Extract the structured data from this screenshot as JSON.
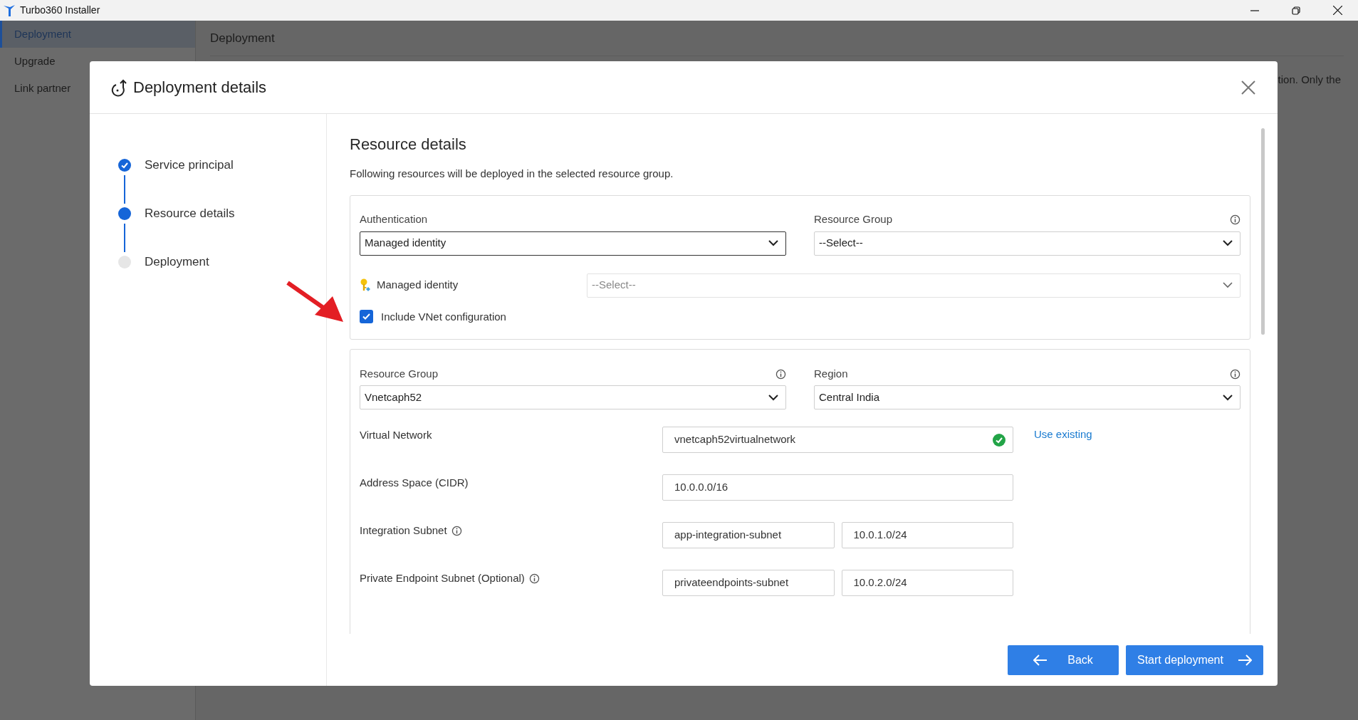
{
  "window": {
    "title": "Turbo360 Installer"
  },
  "sidebar": {
    "items": [
      {
        "label": "Deployment",
        "selected": true
      },
      {
        "label": "Upgrade",
        "selected": false
      },
      {
        "label": "Link partner",
        "selected": false
      }
    ]
  },
  "page": {
    "title": "Deployment",
    "text": "tion. Only the"
  },
  "dialog": {
    "title": "Deployment details",
    "steps": [
      {
        "label": "Service principal",
        "done": true,
        "selected": false
      },
      {
        "label": "Resource details",
        "done": false,
        "selected": true
      },
      {
        "label": "Deployment",
        "done": false,
        "selected": false
      }
    ],
    "section": {
      "title": "Resource details",
      "description": "Following resources will be deployed in the selected resource group."
    },
    "auth_card": {
      "authentication": {
        "label": "Authentication",
        "value": "Managed identity",
        "info": false,
        "focused": true
      },
      "resource_group": {
        "label": "Resource Group",
        "value": "--Select--",
        "info": true,
        "focused": false
      },
      "managed_identity": {
        "label": "Managed identity",
        "placeholder": "--Select--",
        "disabled": true
      },
      "vnet_checkbox": {
        "label": "Include VNet configuration",
        "checked": true
      }
    },
    "vnet_card": {
      "resource_group": {
        "label": "Resource Group",
        "value": "Vnetcaph52",
        "info": true,
        "focused": false
      },
      "region": {
        "label": "Region",
        "value": "Central India",
        "info": true,
        "focused": false
      },
      "rows": [
        {
          "label": "Virtual Network",
          "info": false,
          "fields": [
            "vnetcaph52virtualnetwork"
          ],
          "valid": true,
          "link": "Use existing"
        },
        {
          "label": "Address Space (CIDR)",
          "info": false,
          "fields": [
            "10.0.0.0/16"
          ],
          "valid": false
        },
        {
          "label": "Integration Subnet",
          "info": true,
          "fields": [
            "app-integration-subnet",
            "10.0.1.0/24"
          ],
          "valid": false
        },
        {
          "label": "Private Endpoint Subnet (Optional)",
          "info": true,
          "fields": [
            "privateendpoints-subnet",
            "10.0.2.0/24"
          ],
          "valid": false
        }
      ]
    },
    "buttons": [
      {
        "label": "Back",
        "kind": "back"
      },
      {
        "label": "Start deployment",
        "kind": "next"
      }
    ]
  }
}
